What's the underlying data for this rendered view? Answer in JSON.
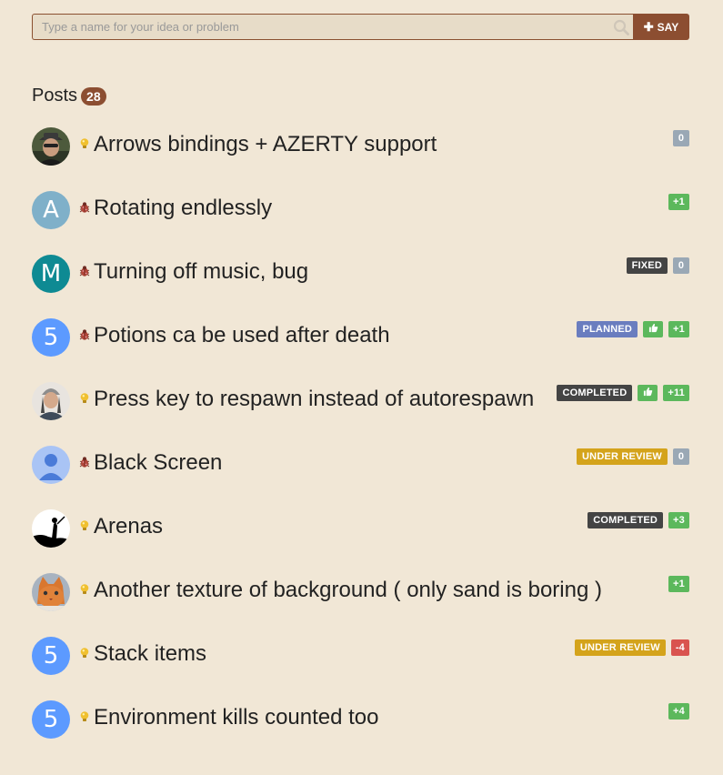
{
  "search": {
    "placeholder": "Type a name for your idea or problem",
    "icon": "search-icon",
    "say_label": "SAY"
  },
  "posts_header": {
    "title": "Posts",
    "count": "28"
  },
  "colors": {
    "brand": "#8c4e31",
    "votes_zero": "#9aa8b5",
    "votes_positive": "#5cb85c",
    "votes_negative": "#d9534f",
    "status_fixed": "#444444",
    "status_planned": "#6a7dbf",
    "status_completed": "#444444",
    "status_under_review": "#d4a31b"
  },
  "posts": [
    {
      "title": "Arrows bindings + AZERTY support",
      "type": "idea",
      "avatar": "photo-man-hat",
      "status": "",
      "liked": false,
      "votes": "0",
      "votes_kind": "zero"
    },
    {
      "title": "Rotating endlessly",
      "type": "bug",
      "avatar": "letter",
      "avatar_letter": "A",
      "avatar_color": "#7fb0c9",
      "status": "",
      "liked": false,
      "votes": "+1",
      "votes_kind": "positive"
    },
    {
      "title": "Turning off music, bug",
      "type": "bug",
      "avatar": "letter",
      "avatar_letter": "M",
      "avatar_color": "#0e8a93",
      "status": "FIXED",
      "status_kind": "fixed",
      "liked": false,
      "votes": "0",
      "votes_kind": "zero"
    },
    {
      "title": "Potions ca be used after death",
      "type": "bug",
      "avatar": "letter",
      "avatar_letter": "5",
      "avatar_color": "#5c9aff",
      "status": "PLANNED",
      "status_kind": "planned",
      "liked": true,
      "votes": "+1",
      "votes_kind": "positive"
    },
    {
      "title": "Press key to respawn instead of autorespawn",
      "type": "idea",
      "avatar": "photo-beanie",
      "status": "COMPLETED",
      "status_kind": "completed",
      "liked": true,
      "votes": "+11",
      "votes_kind": "positive"
    },
    {
      "title": "Black Screen",
      "type": "bug",
      "avatar": "default-user",
      "status": "UNDER REVIEW",
      "status_kind": "under_review",
      "liked": false,
      "votes": "0",
      "votes_kind": "zero"
    },
    {
      "title": "Arenas",
      "type": "idea",
      "avatar": "silhouette",
      "status": "COMPLETED",
      "status_kind": "completed",
      "liked": false,
      "votes": "+3",
      "votes_kind": "positive"
    },
    {
      "title": "Another texture of background ( only sand is boring )",
      "type": "idea",
      "avatar": "photo-cat",
      "status": "",
      "liked": false,
      "votes": "+1",
      "votes_kind": "positive"
    },
    {
      "title": "Stack items",
      "type": "idea",
      "avatar": "letter",
      "avatar_letter": "5",
      "avatar_color": "#5c9aff",
      "status": "UNDER REVIEW",
      "status_kind": "under_review",
      "liked": false,
      "votes": "-4",
      "votes_kind": "negative"
    },
    {
      "title": "Environment kills counted too",
      "type": "idea",
      "avatar": "letter",
      "avatar_letter": "5",
      "avatar_color": "#5c9aff",
      "status": "",
      "liked": false,
      "votes": "+4",
      "votes_kind": "positive"
    }
  ]
}
